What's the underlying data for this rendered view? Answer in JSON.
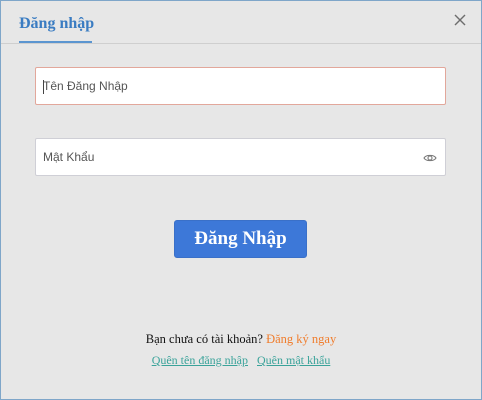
{
  "header": {
    "tab_label": "Đăng nhập"
  },
  "form": {
    "username": {
      "placeholder": "Tên Đăng Nhập",
      "value": ""
    },
    "password": {
      "placeholder": "Mật Khẩu",
      "value": ""
    },
    "submit_label": "Đăng Nhập"
  },
  "footer": {
    "no_account_text": "Bạn chưa có tài khoản?",
    "register_label": "Đăng ký ngay",
    "forgot_username_label": "Quên tên đăng nhập",
    "forgot_password_label": "Quên mật khẩu"
  },
  "icons": {
    "close": "close-icon",
    "password_toggle": "eye-icon"
  },
  "colors": {
    "accent": "#3a7cc2",
    "button": "#3d78d8",
    "register_link": "#f07d2d",
    "footer_links": "#3aa39a",
    "active_field_border": "#e2a79b"
  }
}
